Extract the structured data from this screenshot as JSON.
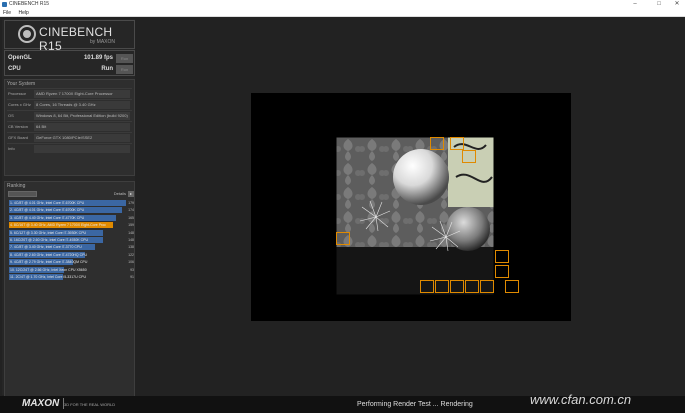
{
  "window": {
    "title": "CINEBENCH R15"
  },
  "menu": [
    {
      "label": "File"
    },
    {
      "label": "Help"
    }
  ],
  "logo": {
    "brand": "CINEBENCH R15",
    "sub": "by MAXON"
  },
  "tests": [
    {
      "name": "OpenGL",
      "value": "101.89 fps",
      "button": "Run"
    },
    {
      "name": "CPU",
      "value": "Run",
      "button": "Run"
    }
  ],
  "system": {
    "heading": "Your System",
    "rows": [
      {
        "key": "Processor",
        "value": "AMD Ryzen 7 1700X Eight-Core Processor"
      },
      {
        "key": "Cores x GHz",
        "value": "8 Cores, 16 Threads @ 3.40 GHz"
      },
      {
        "key": "OS",
        "value": "Windows 8, 64 Bit, Professional Edition (build 9200)"
      },
      {
        "key": "CB Version",
        "value": "64 Bit"
      },
      {
        "key": "GFX Board",
        "value": "GeForce GTX 1080/PCIe/SSE2"
      },
      {
        "key": "Info",
        "value": ""
      }
    ]
  },
  "ranking": {
    "heading": "Ranking",
    "details": "Details",
    "items": [
      {
        "label": "1. 4C/8T @ 4.01 GHz, Intel Core i7-6700K CPU",
        "score": "179",
        "fraction": 0.99,
        "highlight": false
      },
      {
        "label": "2. 4C/8T @ 4.01 GHz, Intel Core i7-6700K CPU",
        "score": "174",
        "fraction": 0.96,
        "highlight": false
      },
      {
        "label": "3. 4C/8T @ 4.40 GHz, Intel Core i7-4770K CPU",
        "score": "165",
        "fraction": 0.91,
        "highlight": false
      },
      {
        "label": "4. 8C/16T @ 3.40 GHz, AMD Ryzen 7 1700X Eight-Core Proc",
        "score": "159",
        "fraction": 0.88,
        "highlight": true
      },
      {
        "label": "5. 6C/12T @ 3.30 GHz, Intel Core i7-3930K CPU",
        "score": "148",
        "fraction": 0.8,
        "highlight": false
      },
      {
        "label": "6. 16C/20T @ 2.60 GHz, Intel Core i7-4930K CPU",
        "score": "148",
        "fraction": 0.8,
        "highlight": false
      },
      {
        "label": "7. 4C/8T @ 3.40 GHz, Intel Core i7-3770 CPU",
        "score": "138",
        "fraction": 0.73,
        "highlight": false
      },
      {
        "label": "8. 4C/8T @ 2.60 GHz, Intel Core i7-4720HQ CPU",
        "score": "122",
        "fraction": 0.64,
        "highlight": false
      },
      {
        "label": "9. 4C/8T @ 2.79 GHz, Intel Core i7-3840QM CPU",
        "score": "106",
        "fraction": 0.54,
        "highlight": false
      },
      {
        "label": "10. 12C/24T @ 2.66 GHz, Intel Xeon CPU X5650",
        "score": "93",
        "fraction": 0.47,
        "highlight": false
      },
      {
        "label": "11. 2C/4T @ 1.70 GHz, Intel Core i5-3317U CPU",
        "score": "91",
        "fraction": 0.46,
        "highlight": false
      }
    ],
    "colors": {
      "bar": "#3b67a3",
      "highlight": "#e08a00"
    }
  },
  "legend": {
    "your_score": "Your Score",
    "identical": "Identical System",
    "your_color": "#e08a00",
    "identical_color": "#a15a00"
  },
  "footer": {
    "brand": "MAXON",
    "tagline": "3D FOR THE REAL WORLD",
    "status": "Performing Render Test ... Rendering",
    "watermark": "www.cfan.com.cn"
  }
}
